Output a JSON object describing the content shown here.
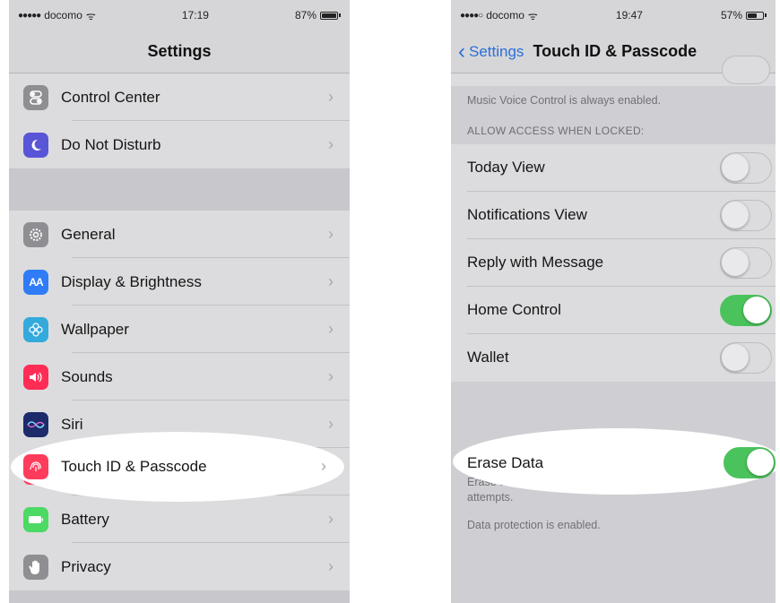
{
  "left": {
    "status": {
      "carrier": "docomo",
      "time": "17:19",
      "battery": "87%",
      "battery_level": 0.87
    },
    "title": "Settings",
    "group1": [
      {
        "label": "Control Center",
        "icon": "control-center-icon",
        "color": "#8e8e93"
      },
      {
        "label": "Do Not Disturb",
        "icon": "moon-icon",
        "color": "#5856d6"
      }
    ],
    "group2": [
      {
        "label": "General",
        "icon": "gear-icon",
        "color": "#8e8e93"
      },
      {
        "label": "Display & Brightness",
        "icon": "display-icon",
        "color": "#2f7cf6"
      },
      {
        "label": "Wallpaper",
        "icon": "wallpaper-icon",
        "color": "#34aadc"
      },
      {
        "label": "Sounds",
        "icon": "speaker-icon",
        "color": "#ff2d55"
      },
      {
        "label": "Siri",
        "icon": "siri-icon",
        "color": "#1d2b6b"
      },
      {
        "label": "Touch ID & Passcode",
        "icon": "fingerprint-icon",
        "color": "#ff3b5c"
      },
      {
        "label": "Battery",
        "icon": "battery-icon",
        "color": "#4cd964"
      },
      {
        "label": "Privacy",
        "icon": "hand-icon",
        "color": "#8e8e93"
      }
    ]
  },
  "right": {
    "status": {
      "carrier": "docomo",
      "time": "19:47",
      "battery": "57%",
      "battery_level": 0.57
    },
    "back_label": "Settings",
    "title": "Touch ID & Passcode",
    "note_voice": "Music Voice Control is always enabled.",
    "section_header": "ALLOW ACCESS WHEN LOCKED:",
    "toggles": [
      {
        "label": "Today View",
        "on": false
      },
      {
        "label": "Notifications View",
        "on": false
      },
      {
        "label": "Reply with Message",
        "on": false
      },
      {
        "label": "Home Control",
        "on": true
      },
      {
        "label": "Wallet",
        "on": false
      }
    ],
    "erase": {
      "label": "Erase Data",
      "on": true
    },
    "erase_note": "Erase all data on this iPhone after 10 failed passcode attempts.",
    "protection_note": "Data protection is enabled."
  }
}
